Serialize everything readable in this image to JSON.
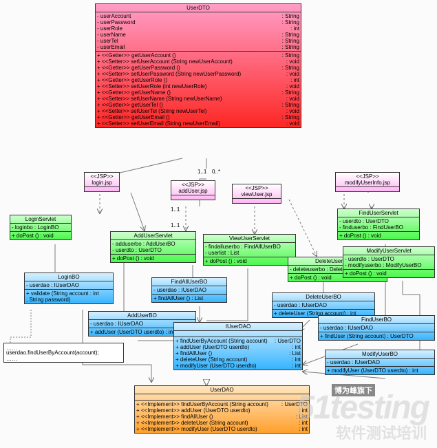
{
  "userDTO": {
    "title": "UserDTO",
    "attrs": [
      [
        "- userAccount",
        ": String"
      ],
      [
        "- userPassword",
        ": String"
      ],
      [
        "- userRole",
        ": int"
      ],
      [
        "- userName",
        ": String"
      ],
      [
        "- userTel",
        ": String"
      ],
      [
        "- userEmail",
        ": String"
      ]
    ],
    "ops": [
      [
        "+ <<Getter>> getUserAccount ()",
        ": String"
      ],
      [
        "+ <<Setter>> setUserAccount (String newUserAccount)",
        ": void"
      ],
      [
        "+ <<Getter>> getUserPassword ()",
        ": String"
      ],
      [
        "+ <<Setter>> setUserPassword (String newUserPassword)",
        ": void"
      ],
      [
        "+ <<Getter>> getUserRole ()",
        ": int"
      ],
      [
        "+ <<Setter>> setUserRole (int newUserRole)",
        ": void"
      ],
      [
        "+ <<Getter>> getUserName ()",
        ": String"
      ],
      [
        "+ <<Setter>> setUserName (String newUserName)",
        ": void"
      ],
      [
        "+ <<Getter>> getUserTel ()",
        ": String"
      ],
      [
        "+ <<Setter>> setUserTel (String newUserTel)",
        ": void"
      ],
      [
        "+ <<Getter>> getUserEmail ()",
        ": String"
      ],
      [
        "+ <<Setter>> setUserEmail (String newUserEmail)",
        ": void"
      ]
    ]
  },
  "loginJsp": {
    "stereo": "<<JSP>>",
    "name": "login.jsp"
  },
  "addUserJsp": {
    "stereo": "<<JSP>>",
    "name": "addUser.jsp"
  },
  "viewUserJsp": {
    "stereo": "<<JSP>>",
    "name": "viewUser.jsp"
  },
  "modifyJsp": {
    "stereo": "<<JSP>>",
    "name": "modifyUserInfo.jsp"
  },
  "loginServlet": {
    "title": "LoginServlet",
    "attrs": [
      [
        "- loginbo : LoginBO",
        ""
      ]
    ],
    "ops": [
      [
        "+ doPost () : void",
        ""
      ]
    ]
  },
  "addUserServlet": {
    "title": "AddUserServlet",
    "attrs": [
      [
        "- adduserbo : AddUserBO",
        ""
      ],
      [
        "- userdto     : UserDTO",
        ""
      ]
    ],
    "ops": [
      [
        "+ doPost () : void",
        ""
      ]
    ]
  },
  "viewUserServlet": {
    "title": "ViewUserServlet",
    "attrs": [
      [
        "- findalluserbo : FindAllUserBO",
        ""
      ],
      [
        "- userlist         : List",
        ""
      ]
    ],
    "ops": [
      [
        "+ doPost () : void",
        ""
      ]
    ]
  },
  "findUserServlet": {
    "title": "FindUserServlet",
    "attrs": [
      [
        "- userdto      : UserDTO",
        ""
      ],
      [
        "- finduserbo : FindUserBO",
        ""
      ]
    ],
    "ops": [
      [
        "+ doPost () : void",
        ""
      ]
    ]
  },
  "deleteUserServlet": {
    "title": "DeleteUserServlet",
    "attrs": [
      [
        "- deleteuserbo : DeleteUserBO",
        ""
      ]
    ],
    "ops": [
      [
        "+ doPost () : void",
        ""
      ]
    ]
  },
  "modifyUserServlet": {
    "title": "ModifyUserServlet",
    "attrs": [
      [
        "- userdto           : UserDTO",
        ""
      ],
      [
        "- modifyuserbo : ModifyUserBO",
        ""
      ]
    ],
    "ops": [
      [
        "+ doPost () : void",
        ""
      ]
    ]
  },
  "loginBO": {
    "title": "LoginBO",
    "attrs": [
      [
        "- userdao : IUserDAO",
        ""
      ]
    ],
    "ops": [
      [
        "+ validate (String account : int",
        ""
      ],
      [
        "   , String password)",
        ""
      ]
    ]
  },
  "findAllUserBO": {
    "title": "FindAllUserBO",
    "attrs": [
      [
        "- userdao : IUserDAO",
        ""
      ]
    ],
    "ops": [
      [
        "+ findAllUser () : List",
        ""
      ]
    ]
  },
  "addUserBO": {
    "title": "AddUserBO",
    "attrs": [
      [
        "- userdao : IUserDAO",
        ""
      ]
    ],
    "ops": [
      [
        "+ addUser (UserDTO userdto) : int",
        ""
      ]
    ]
  },
  "deleteUserBO": {
    "title": "DeleteUserBO",
    "attrs": [
      [
        "- userdao : IUserDAO",
        ""
      ]
    ],
    "ops": [
      [
        "+ deleteUser (String account) : int",
        ""
      ]
    ]
  },
  "findUserBO": {
    "title": "FindUserBO",
    "attrs": [
      [
        "- userdao : IUserDAO",
        ""
      ]
    ],
    "ops": [
      [
        "+ findUser (String account) : UserDTO",
        ""
      ]
    ]
  },
  "modifyUserBO": {
    "title": "ModifyUserBO",
    "attrs": [
      [
        "- userdao : IUserDAO",
        ""
      ]
    ],
    "ops": [
      [
        "+ modifyUser (UserDTO userdto) : int",
        ""
      ]
    ]
  },
  "iUserDAO": {
    "title": "IUserDAO",
    "ops": [
      [
        "+ findUserByAccount (String account)",
        ": UserDTO"
      ],
      [
        "+ addUser (UserDTO userdto)",
        ": int"
      ],
      [
        "+ findAllUser ()",
        ": List"
      ],
      [
        "+ deleteUser (String account)",
        ": int"
      ],
      [
        "+ modifyUser (UserDTO userdto)",
        ": int"
      ]
    ]
  },
  "userDAO": {
    "title": "UserDAO",
    "ops": [
      [
        "+ <<Implement>> findUserByAccount (String account)",
        ": UserDTO"
      ],
      [
        "+ <<Implement>> addUser (UserDTO userdto)",
        ": int"
      ],
      [
        "+ <<Implement>> findAllUser ()",
        ": List"
      ],
      [
        "+ <<Implement>> deleteUser (String account)",
        ": int"
      ],
      [
        "+ <<Implement>> modifyUser (UserDTO userdto)",
        ": int"
      ]
    ]
  },
  "note": {
    "text": "userdao.findUserByAccount(account);"
  },
  "mult": {
    "a": "1..1",
    "b": "0..*",
    "c": "1..1",
    "d": "1..1"
  },
  "wm": {
    "a": "博为峰旗下",
    "b": "软件测试培训"
  }
}
